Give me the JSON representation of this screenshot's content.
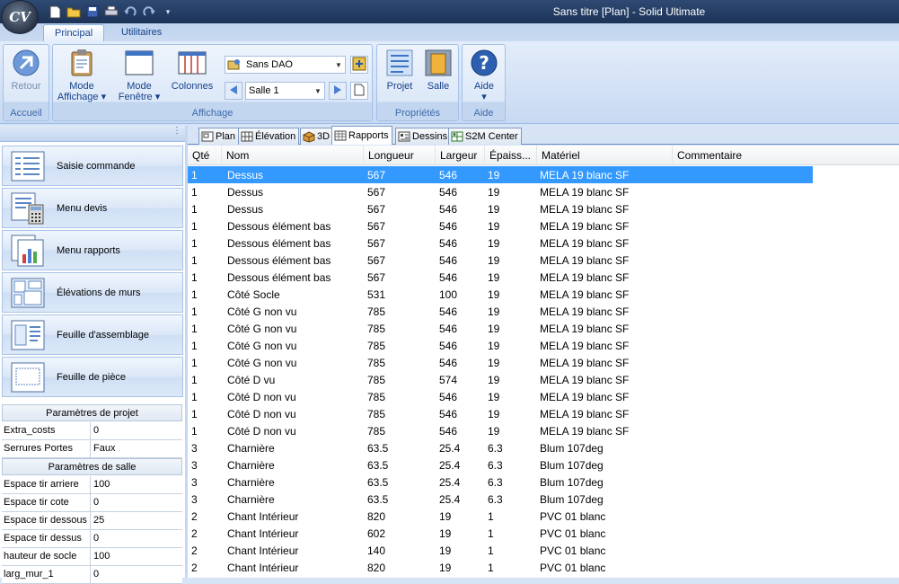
{
  "window": {
    "title": "Sans titre [Plan] - Solid Ultimate",
    "app_logo": "CV"
  },
  "quick_access": [
    "new-file-icon",
    "open-folder-icon",
    "save-icon",
    "print-icon",
    "undo-icon",
    "redo-icon",
    "customize-qat-icon"
  ],
  "ribbon_tabs": [
    {
      "label": "Principal",
      "active": true
    },
    {
      "label": "Utilitaires",
      "active": false
    }
  ],
  "ribbon": {
    "accueil": {
      "label": "Accueil",
      "retour": "Retour"
    },
    "affichage": {
      "label": "Affichage",
      "mode_affichage_1": "Mode",
      "mode_affichage_2": "Affichage",
      "mode_fenetre_1": "Mode",
      "mode_fenetre_2": "Fenêtre",
      "colonnes": "Colonnes",
      "dao_combo": "Sans DAO",
      "salle_combo": "Salle 1"
    },
    "proprietes": {
      "label": "Propriétés",
      "projet": "Projet",
      "salle": "Salle"
    },
    "aide": {
      "label": "Aide",
      "aide": "Aide"
    }
  },
  "sidebar": {
    "grip": "⋮",
    "nav": [
      {
        "label": "Saisie commande",
        "icon": "order-entry-icon"
      },
      {
        "label": "Menu devis",
        "icon": "calculator-quote-icon"
      },
      {
        "label": "Menu rapports",
        "icon": "report-chart-icon"
      },
      {
        "label": "Élévations de murs",
        "icon": "wall-elevation-icon"
      },
      {
        "label": "Feuille d'assemblage",
        "icon": "assembly-sheet-icon"
      },
      {
        "label": "Feuille de pièce",
        "icon": "part-sheet-icon"
      }
    ],
    "project_params": {
      "title": "Paramètres de projet",
      "rows": [
        {
          "key": "Extra_costs",
          "value": "0"
        },
        {
          "key": "Serrures Portes",
          "value": "Faux"
        }
      ]
    },
    "room_params": {
      "title": "Paramètres de salle",
      "rows": [
        {
          "key": "Espace tir arriere",
          "value": "100"
        },
        {
          "key": "Espace tir cote",
          "value": "0"
        },
        {
          "key": "Espace tir dessous",
          "value": "25"
        },
        {
          "key": "Espace tir dessus",
          "value": "0"
        },
        {
          "key": "hauteur de socle",
          "value": "100"
        },
        {
          "key": "larg_mur_1",
          "value": "0"
        }
      ]
    }
  },
  "view_tabs": [
    {
      "label": "Plan",
      "icon": "plan-icon",
      "active": false
    },
    {
      "label": "Élévation",
      "icon": "elevation-icon",
      "active": false
    },
    {
      "label": "3D",
      "icon": "cube-3d-icon",
      "active": false
    },
    {
      "label": "Rapports",
      "icon": "report-grid-icon",
      "active": true
    },
    {
      "label": "Dessins",
      "icon": "drawings-icon",
      "active": false
    },
    {
      "label": "S2M Center",
      "icon": "s2m-center-icon",
      "active": false
    }
  ],
  "report": {
    "columns": [
      "Qté",
      "Nom",
      "Longueur",
      "Largeur",
      "Épaiss...",
      "Matériel",
      "Commentaire"
    ],
    "selected_row": 0,
    "rows": [
      [
        "1",
        "Dessus",
        "567",
        "546",
        "19",
        "MELA 19 blanc SF",
        ""
      ],
      [
        "1",
        "Dessus",
        "567",
        "546",
        "19",
        "MELA 19 blanc SF",
        ""
      ],
      [
        "1",
        "Dessus",
        "567",
        "546",
        "19",
        "MELA 19 blanc SF",
        ""
      ],
      [
        "1",
        "Dessous élément bas",
        "567",
        "546",
        "19",
        "MELA 19 blanc SF",
        ""
      ],
      [
        "1",
        "Dessous élément bas",
        "567",
        "546",
        "19",
        "MELA 19 blanc SF",
        ""
      ],
      [
        "1",
        "Dessous élément bas",
        "567",
        "546",
        "19",
        "MELA 19 blanc SF",
        ""
      ],
      [
        "1",
        "Dessous élément bas",
        "567",
        "546",
        "19",
        "MELA 19 blanc SF",
        ""
      ],
      [
        "1",
        "Côté Socle",
        "531",
        "100",
        "19",
        "MELA 19 blanc SF",
        ""
      ],
      [
        "1",
        "Côté G non vu",
        "785",
        "546",
        "19",
        "MELA 19 blanc SF",
        ""
      ],
      [
        "1",
        "Côté G non vu",
        "785",
        "546",
        "19",
        "MELA 19 blanc SF",
        ""
      ],
      [
        "1",
        "Côté G non vu",
        "785",
        "546",
        "19",
        "MELA 19 blanc SF",
        ""
      ],
      [
        "1",
        "Côté G non vu",
        "785",
        "546",
        "19",
        "MELA 19 blanc SF",
        ""
      ],
      [
        "1",
        "Côté D vu",
        "785",
        "574",
        "19",
        "MELA 19 blanc SF",
        ""
      ],
      [
        "1",
        "Côté D non vu",
        "785",
        "546",
        "19",
        "MELA 19 blanc SF",
        ""
      ],
      [
        "1",
        "Côté D non vu",
        "785",
        "546",
        "19",
        "MELA 19 blanc SF",
        ""
      ],
      [
        "1",
        "Côté D non vu",
        "785",
        "546",
        "19",
        "MELA 19 blanc SF",
        ""
      ],
      [
        "3",
        "Charnière",
        "63.5",
        "25.4",
        "6.3",
        "Blum 107deg",
        ""
      ],
      [
        "3",
        "Charnière",
        "63.5",
        "25.4",
        "6.3",
        "Blum 107deg",
        ""
      ],
      [
        "3",
        "Charnière",
        "63.5",
        "25.4",
        "6.3",
        "Blum 107deg",
        ""
      ],
      [
        "3",
        "Charnière",
        "63.5",
        "25.4",
        "6.3",
        "Blum 107deg",
        ""
      ],
      [
        "2",
        "Chant Intérieur",
        "820",
        "19",
        "1",
        "PVC 01 blanc",
        ""
      ],
      [
        "2",
        "Chant Intérieur",
        "602",
        "19",
        "1",
        "PVC 01 blanc",
        ""
      ],
      [
        "2",
        "Chant Intérieur",
        "140",
        "19",
        "1",
        "PVC 01 blanc",
        ""
      ],
      [
        "2",
        "Chant Intérieur",
        "820",
        "19",
        "1",
        "PVC 01 blanc",
        ""
      ]
    ]
  },
  "colors": {
    "selection": "#3399ff",
    "titlebar": "#2e4a73",
    "ribbon": "#dce8f8"
  }
}
